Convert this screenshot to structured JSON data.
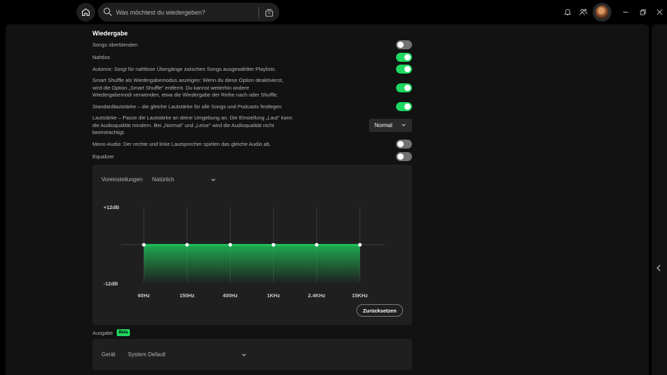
{
  "search": {
    "placeholder": "Was möchtest du wiedergeben?"
  },
  "window_controls": [
    "minimize-icon",
    "restore-icon",
    "close-icon"
  ],
  "playback": {
    "title": "Wiedergabe",
    "crossfade": {
      "label": "Songs überblenden",
      "on": false
    },
    "gapless": {
      "label": "Nahtlos",
      "on": true
    },
    "automix": {
      "label": "Automix: Sorgt für nahtlose Übergänge zwischen Songs ausgewählter Playlists.",
      "on": true
    },
    "smart_shuffle": {
      "line1": "Smart Shuffle als Wiedergabemodus anzeigen: Wenn du diese Option deaktivierst,",
      "line2": "wird die Option „Smart Shuffle\" entfernt. Du kannst weiterhin andere",
      "line3": "Wiedergabemodi verwenden, etwa die Wiedergabe der Reihe nach oder Shuffle.",
      "on": true
    },
    "normalize": {
      "label": "Standardlautstärke – die gleiche Lautstärke für alle Songs und Podcasts festlegen",
      "on": true
    },
    "loudness": {
      "line1": "Lautstärke – Passe die Lautstärke an deine Umgebung an. Die Einstellung „Laut\" kann",
      "line2": "die Audioqualität mindern. Bei „Normal\" und „Leise\" wird die Audioqualität nicht",
      "line3": "beeinträchtigt.",
      "value": "Normal"
    },
    "mono": {
      "label": "Mono-Audio: Der rechte und linke Lautsprecher spielen das gleiche Audio ab.",
      "on": false
    },
    "equalizer": {
      "label": "Equalizer",
      "on": false
    }
  },
  "eq": {
    "preset_label": "Voreinstellungen",
    "preset_value": "Natürlich",
    "db_max": "+12dB",
    "db_min": "-12dB",
    "reset_label": "Zurücksetzen",
    "bands": [
      {
        "label": "60Hz",
        "gain": 0
      },
      {
        "label": "150Hz",
        "gain": 0
      },
      {
        "label": "400Hz",
        "gain": 0
      },
      {
        "label": "1KHz",
        "gain": 0
      },
      {
        "label": "2.4KHz",
        "gain": 0
      },
      {
        "label": "15KHz",
        "gain": 0
      }
    ],
    "gain_range": [
      -12,
      12
    ],
    "accent": "#1ed760"
  },
  "output": {
    "label": "Ausgabe",
    "badge": "Beta",
    "device_label": "Gerät",
    "device_value": "System Default"
  }
}
